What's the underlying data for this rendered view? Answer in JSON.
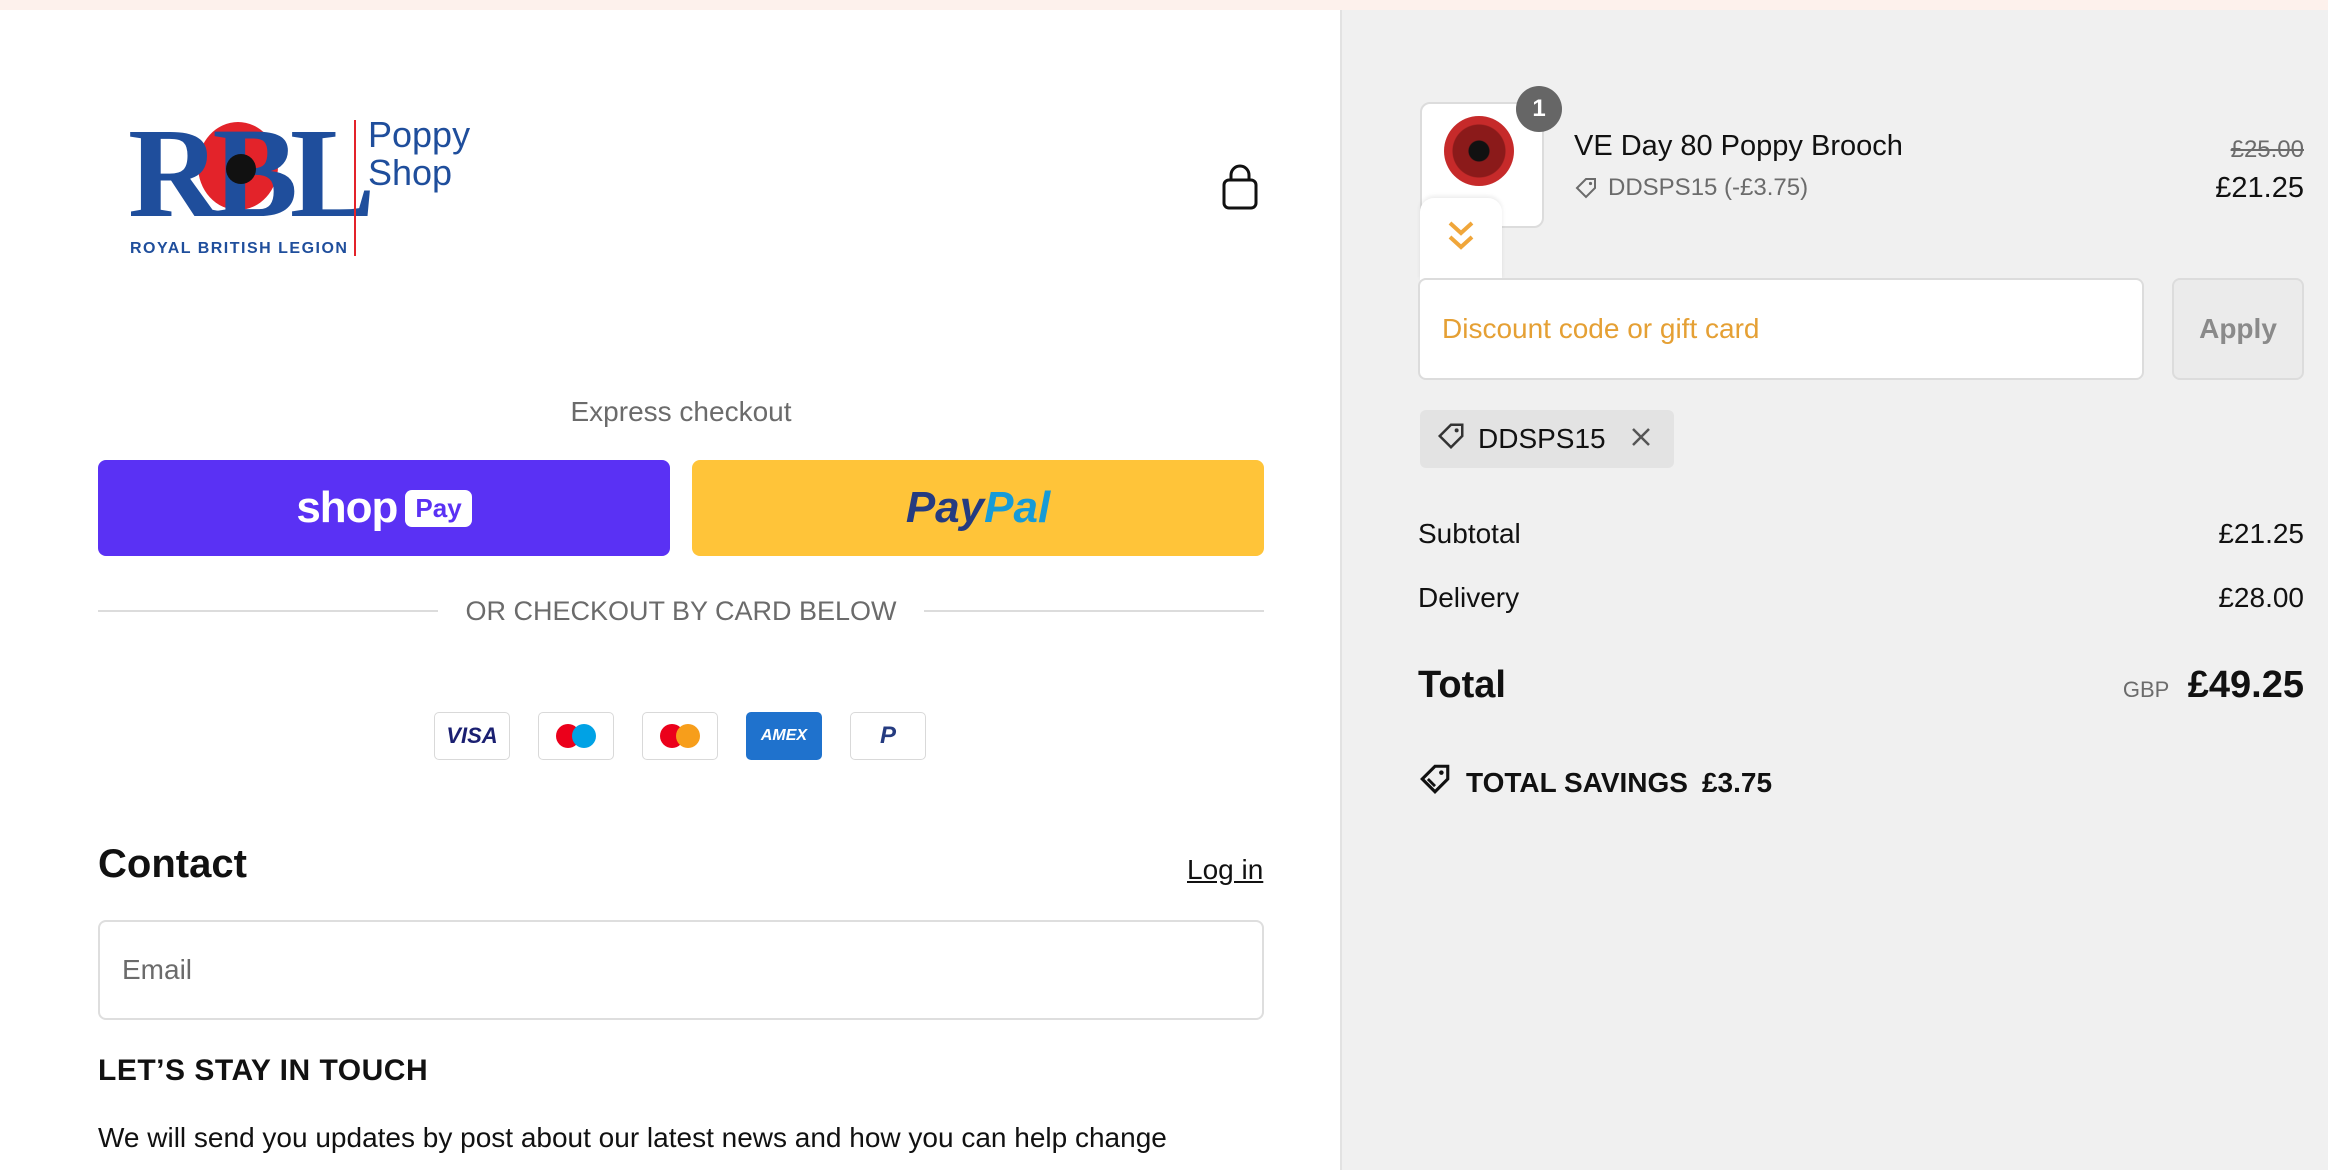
{
  "brand": {
    "logo_text": "RBL",
    "logo_sub": "ROYAL BRITISH LEGION",
    "shop_line1": "Poppy",
    "shop_line2": "Shop"
  },
  "express": {
    "label": "Express checkout",
    "shop_pay_word": "shop",
    "shop_pay_badge": "Pay",
    "paypal_part1": "Pay",
    "paypal_part2": "Pal"
  },
  "divider_text": "OR CHECKOUT BY CARD BELOW",
  "payment_icons": [
    "visa-icon",
    "maestro-icon",
    "mastercard-icon",
    "amex-icon",
    "paypal-icon"
  ],
  "payment_labels": {
    "visa": "VISA",
    "amex": "AMEX",
    "paypal": "P"
  },
  "contact": {
    "heading": "Contact",
    "login": "Log in",
    "email_placeholder": "Email"
  },
  "stay": {
    "heading": "LET’S STAY IN TOUCH",
    "text": "We will send you updates by post about our latest news and how you can help change"
  },
  "order": {
    "item": {
      "name": "VE Day 80 Poppy Brooch",
      "discount_code": "DDSPS15 (-£3.75)",
      "price_original": "£25.00",
      "price": "£21.25",
      "quantity": "1"
    },
    "discount_placeholder": "Discount code or gift card",
    "apply_label": "Apply",
    "applied_code": "DDSPS15",
    "subtotal_label": "Subtotal",
    "subtotal": "£21.25",
    "delivery_label": "Delivery",
    "delivery": "£28.00",
    "total_label": "Total",
    "currency": "GBP",
    "total": "£49.25",
    "savings_label": "TOTAL SAVINGS",
    "savings": "£3.75"
  },
  "colors": {
    "shop_pay": "#5a31f4",
    "paypal": "#ffc439",
    "brand_blue": "#1f4e9c",
    "brand_red": "#e3232a",
    "accent_orange": "#f0a63a"
  }
}
